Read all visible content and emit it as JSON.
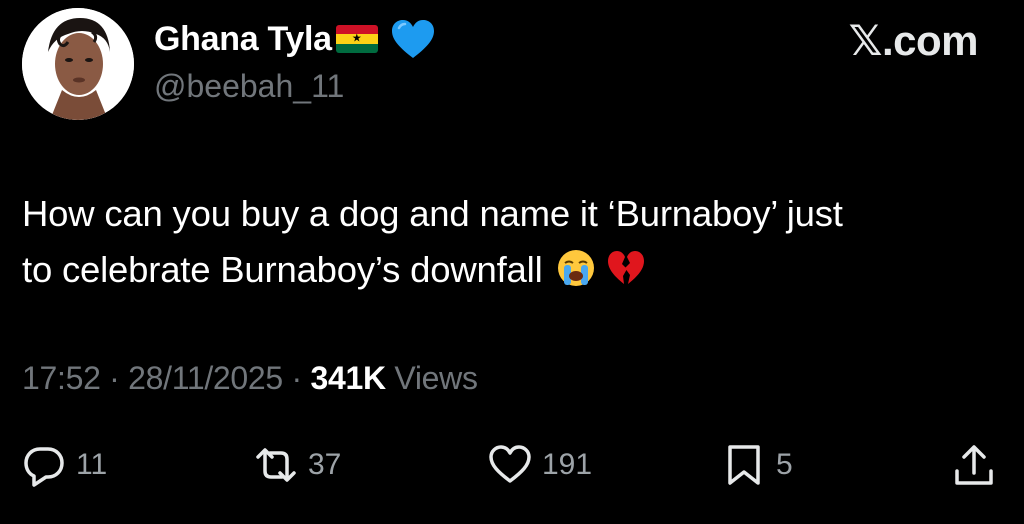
{
  "author": {
    "display_name": "Ghana Tyla",
    "handle": "@beebah_11",
    "flag": "ghana-flag-icon",
    "badge": "blue-heart-icon"
  },
  "brand": {
    "label": "𝕏.com"
  },
  "tweet": {
    "line1": "How can you buy a dog and name it ‘Burnaboy’ just",
    "line2": "to celebrate Burnaboy’s downfall",
    "emojis": [
      "loudly-crying-face-icon",
      "broken-heart-icon"
    ]
  },
  "meta": {
    "time": "17:52",
    "separator": " · ",
    "date": "28/11/2025",
    "views_count": "341K",
    "views_label": "Views"
  },
  "actions": {
    "replies": "11",
    "reposts": "37",
    "likes": "191",
    "bookmarks": "5"
  },
  "colors": {
    "background": "#000000",
    "text": "#ffffff",
    "secondary": "#71767b",
    "heart_blue": "#1d9bf0"
  }
}
